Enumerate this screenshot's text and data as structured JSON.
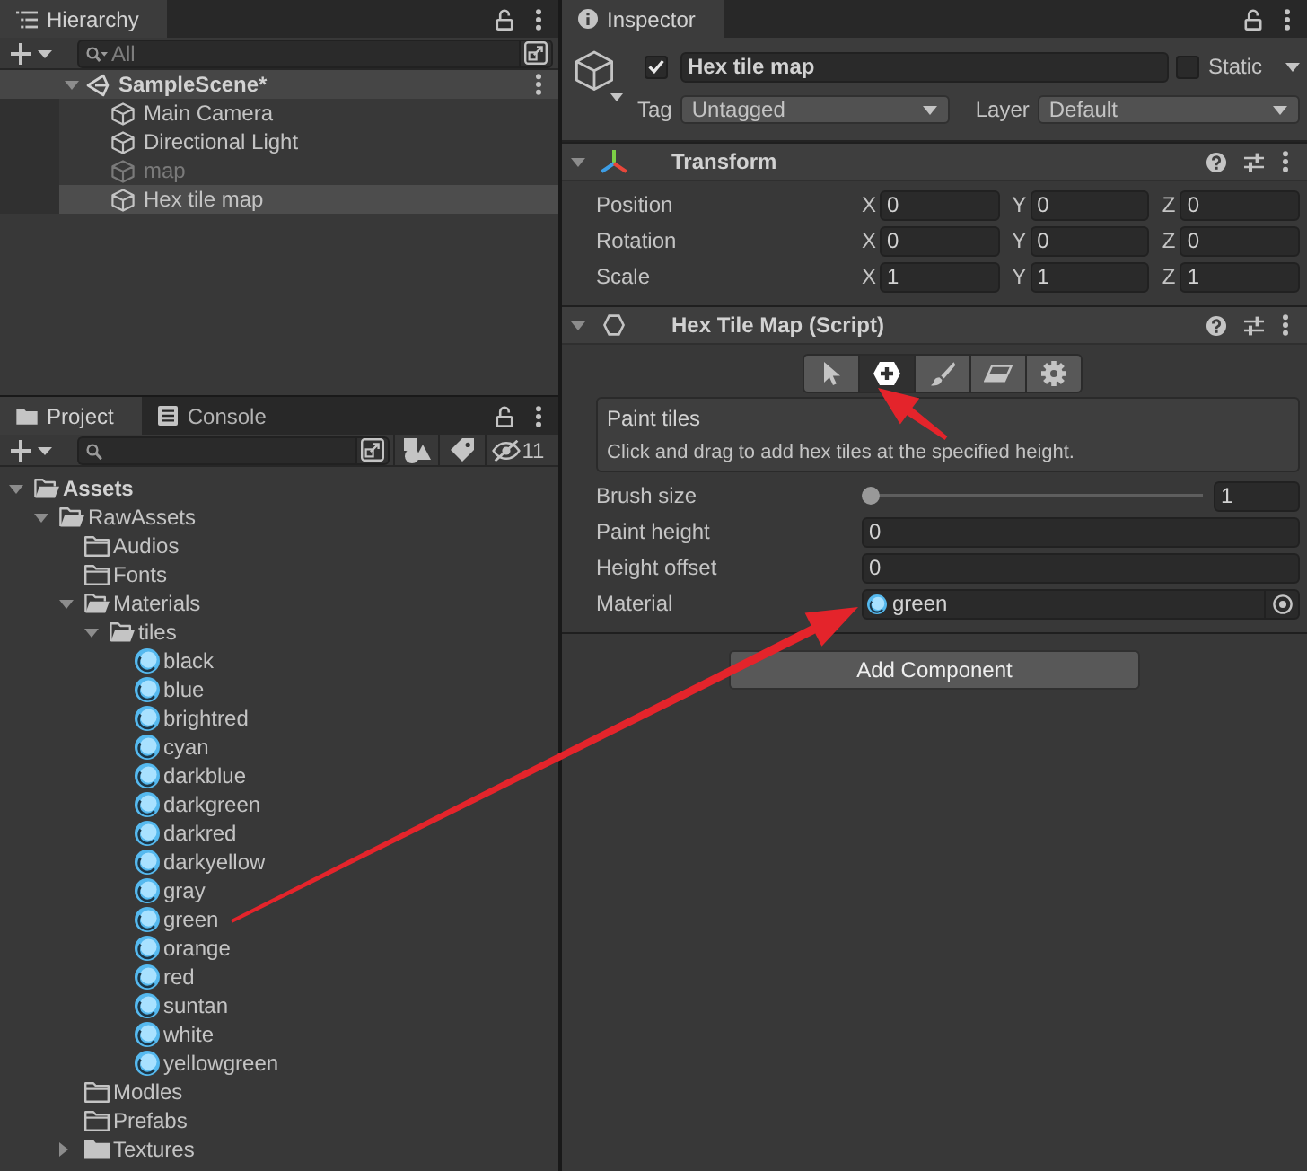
{
  "hierarchy": {
    "tab": {
      "label": "Hierarchy",
      "selected": true
    },
    "search": {
      "placeholder": "All"
    },
    "scene": {
      "name": "SampleScene*",
      "expanded": true,
      "children": [
        {
          "name": "Main Camera",
          "active": true,
          "selected": false
        },
        {
          "name": "Directional Light",
          "active": true,
          "selected": false
        },
        {
          "name": "map",
          "active": false,
          "selected": false
        },
        {
          "name": "Hex tile map",
          "active": true,
          "selected": true
        }
      ]
    }
  },
  "project": {
    "tabs": [
      {
        "label": "Project",
        "kind": "project",
        "selected": true
      },
      {
        "label": "Console",
        "kind": "console",
        "selected": false
      }
    ],
    "hidden_count": "11",
    "tree": [
      {
        "name": "Assets",
        "kind": "folder",
        "expanded": true,
        "children": [
          {
            "name": "RawAssets",
            "kind": "folder",
            "expanded": true,
            "children": [
              {
                "name": "Audios",
                "kind": "empty_folder"
              },
              {
                "name": "Fonts",
                "kind": "empty_folder"
              },
              {
                "name": "Materials",
                "kind": "folder",
                "expanded": true,
                "children": [
                  {
                    "name": "tiles",
                    "kind": "folder",
                    "expanded": true,
                    "children": [
                      {
                        "name": "black",
                        "kind": "material"
                      },
                      {
                        "name": "blue",
                        "kind": "material"
                      },
                      {
                        "name": "brightred",
                        "kind": "material"
                      },
                      {
                        "name": "cyan",
                        "kind": "material"
                      },
                      {
                        "name": "darkblue",
                        "kind": "material"
                      },
                      {
                        "name": "darkgreen",
                        "kind": "material"
                      },
                      {
                        "name": "darkred",
                        "kind": "material"
                      },
                      {
                        "name": "darkyellow",
                        "kind": "material"
                      },
                      {
                        "name": "gray",
                        "kind": "material"
                      },
                      {
                        "name": "green",
                        "kind": "material"
                      },
                      {
                        "name": "orange",
                        "kind": "material"
                      },
                      {
                        "name": "red",
                        "kind": "material"
                      },
                      {
                        "name": "suntan",
                        "kind": "material"
                      },
                      {
                        "name": "white",
                        "kind": "material"
                      },
                      {
                        "name": "yellowgreen",
                        "kind": "material"
                      }
                    ]
                  }
                ]
              },
              {
                "name": "Modles",
                "kind": "empty_folder"
              },
              {
                "name": "Prefabs",
                "kind": "empty_folder"
              },
              {
                "name": "Textures",
                "kind": "folder",
                "expanded": false
              }
            ]
          }
        ]
      }
    ]
  },
  "inspector": {
    "tab": {
      "label": "Inspector",
      "selected": true
    },
    "object": {
      "active": true,
      "name": "Hex tile map",
      "static": false,
      "static_label": "Static",
      "tag": {
        "label": "Tag",
        "value": "Untagged"
      },
      "layer": {
        "label": "Layer",
        "value": "Default"
      }
    },
    "components": [
      {
        "kind": "transform",
        "title": "Transform",
        "expanded": true,
        "rows": [
          {
            "label": "Position",
            "fields": [
              {
                "axis": "X",
                "value": "0"
              },
              {
                "axis": "Y",
                "value": "0"
              },
              {
                "axis": "Z",
                "value": "0"
              }
            ]
          },
          {
            "label": "Rotation",
            "fields": [
              {
                "axis": "X",
                "value": "0"
              },
              {
                "axis": "Y",
                "value": "0"
              },
              {
                "axis": "Z",
                "value": "0"
              }
            ]
          },
          {
            "label": "Scale",
            "fields": [
              {
                "axis": "X",
                "value": "1"
              },
              {
                "axis": "Y",
                "value": "1"
              },
              {
                "axis": "Z",
                "value": "1"
              }
            ]
          }
        ]
      },
      {
        "kind": "script",
        "title": "Hex Tile Map (Script)",
        "expanded": true,
        "tools": [
          {
            "kind": "select",
            "selected": false
          },
          {
            "kind": "add",
            "selected": true
          },
          {
            "kind": "paint",
            "selected": false
          },
          {
            "kind": "erase",
            "selected": false
          },
          {
            "kind": "settings",
            "selected": false
          }
        ],
        "help": {
          "title": "Paint tiles",
          "text": "Click and drag to add hex tiles at the specified height."
        },
        "properties": [
          {
            "kind": "slider",
            "label": "Brush size",
            "level": 0,
            "value": "1"
          },
          {
            "kind": "number",
            "label": "Paint height",
            "value": "0"
          },
          {
            "kind": "number",
            "label": "Height offset",
            "value": "0"
          },
          {
            "kind": "object",
            "label": "Material",
            "value": "green"
          }
        ]
      }
    ],
    "add_component": "Add Component"
  },
  "annotations": [
    {
      "kind": "arrow"
    },
    {
      "kind": "arrow"
    }
  ]
}
